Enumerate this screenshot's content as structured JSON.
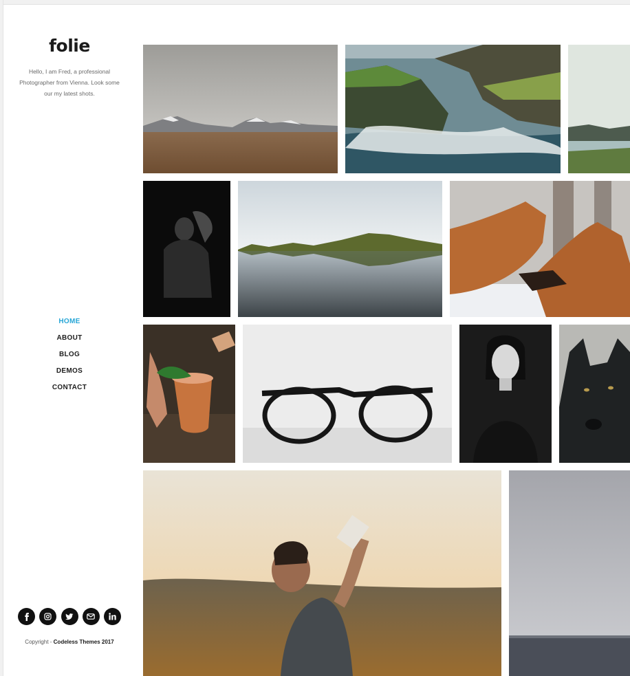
{
  "site": {
    "logo": "folie",
    "intro": "Hello, I am Fred, a professional Photographer from Vienna. Look some our my latest shots."
  },
  "nav": {
    "items": [
      {
        "label": "HOME",
        "active": true
      },
      {
        "label": "ABOUT",
        "active": false
      },
      {
        "label": "BLOG",
        "active": false
      },
      {
        "label": "DEMOS",
        "active": false
      },
      {
        "label": "CONTACT",
        "active": false
      }
    ]
  },
  "social": {
    "icons": [
      "facebook-icon",
      "instagram-icon",
      "twitter-icon",
      "email-icon",
      "linkedin-icon"
    ]
  },
  "footer": {
    "copyright_prefix": "Copyright - ",
    "copyright_brand": "Codeless Themes 2017"
  },
  "colors": {
    "accent": "#27a6d6",
    "text_dark": "#1e1e1e",
    "social_bg": "#111111"
  },
  "gallery": {
    "items": [
      {
        "subject": "desert-mountains-photo"
      },
      {
        "subject": "rocky-coast-photo"
      },
      {
        "subject": "misty-lake-photo"
      },
      {
        "subject": "man-in-dark-photo"
      },
      {
        "subject": "mountain-lake-reflection-photo"
      },
      {
        "subject": "fighting-foxes-photo"
      },
      {
        "subject": "cocktail-copper-mug-photo"
      },
      {
        "subject": "eyeglasses-photo"
      },
      {
        "subject": "woman-portrait-photo"
      },
      {
        "subject": "wolf-photo"
      },
      {
        "subject": "man-drinking-photo"
      },
      {
        "subject": "grey-sea-photo"
      }
    ]
  }
}
